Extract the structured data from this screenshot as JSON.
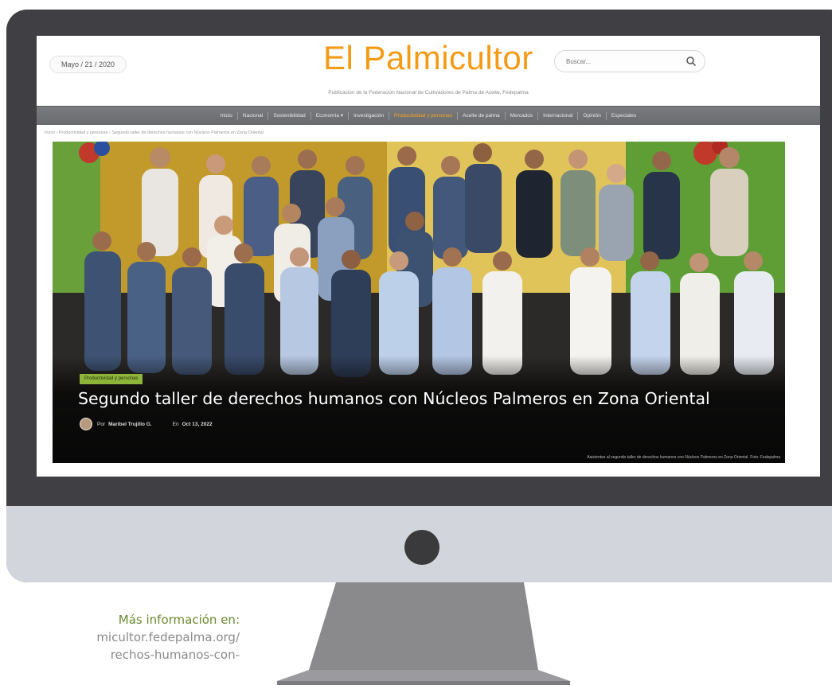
{
  "site": {
    "date": "Mayo / 21 / 2020",
    "logo": "El Palmicultor",
    "search_placeholder": "Buscar...",
    "tagline": "Publicación de la Federación Nacional de Cultivadores de Palma de Aceite, Fedepalma"
  },
  "nav": {
    "items": [
      {
        "label": "Inicio",
        "active": false
      },
      {
        "label": "Nacional",
        "active": false
      },
      {
        "label": "Sostenibilidad",
        "active": false
      },
      {
        "label": "Economía ▾",
        "active": false
      },
      {
        "label": "Investigación",
        "active": false
      },
      {
        "label": "Productividad y personas",
        "active": true
      },
      {
        "label": "Aceite de palma",
        "active": false
      },
      {
        "label": "Mercados",
        "active": false
      },
      {
        "label": "Internacional",
        "active": false
      },
      {
        "label": "Opinión",
        "active": false
      },
      {
        "label": "Especiales",
        "active": false
      }
    ]
  },
  "breadcrumb": "Inicio  ›  Productividad y personas  ›  Segundo taller de derechos humanos con Núcleos Palmeros en Zona Oriental",
  "article": {
    "category": "Productividad y personas",
    "title": "Segundo taller de derechos humanos con Núcleos Palmeros en Zona Oriental",
    "by_label": "Por",
    "author": "Maribel Trujillo G.",
    "on_label": "En",
    "date": "Oct 13, 2022",
    "photo_credit": "Asistentes al segundo taller de derechos humanos con Núcleos Palmeros en Zona Oriental. Foto: Fedepalma"
  },
  "side": {
    "label": "Más información en:",
    "url_line1": "micultor.fedepalma.org/",
    "url_line2": "rechos-humanos-con-"
  },
  "colors": {
    "accent": "#f49b16",
    "badge": "#8fb43a",
    "bezel": "#404044",
    "chin": "#d2d5dc"
  }
}
